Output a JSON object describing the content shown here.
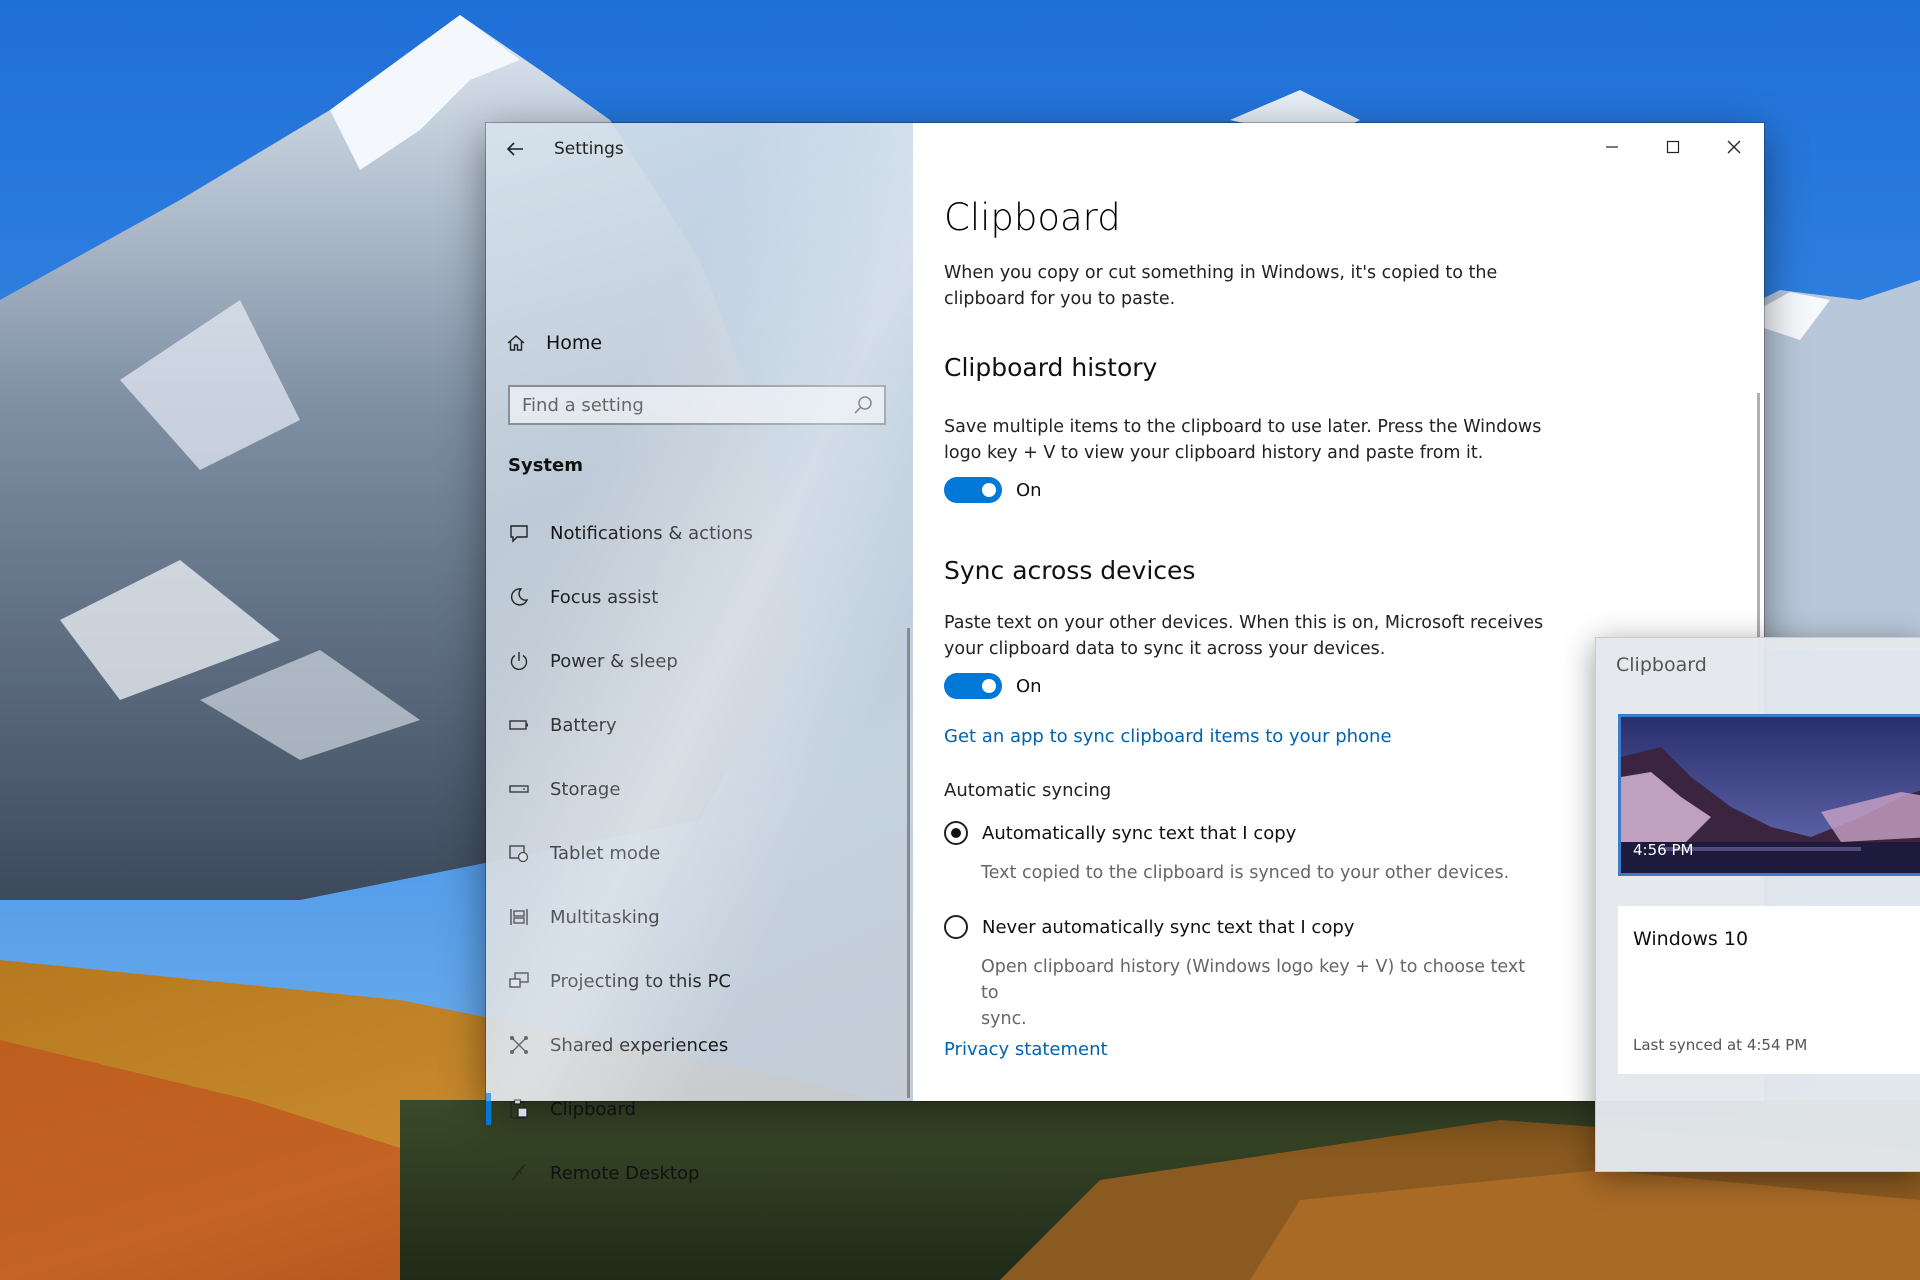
{
  "window": {
    "title": "Settings"
  },
  "nav": {
    "home_label": "Home",
    "search_placeholder": "Find a setting",
    "section_label": "System",
    "items": [
      {
        "label": "Notifications & actions",
        "icon": "notifications-icon"
      },
      {
        "label": "Focus assist",
        "icon": "moon-icon"
      },
      {
        "label": "Power & sleep",
        "icon": "power-icon"
      },
      {
        "label": "Battery",
        "icon": "battery-icon"
      },
      {
        "label": "Storage",
        "icon": "storage-icon"
      },
      {
        "label": "Tablet mode",
        "icon": "tablet-icon"
      },
      {
        "label": "Multitasking",
        "icon": "multitasking-icon"
      },
      {
        "label": "Projecting to this PC",
        "icon": "projecting-icon"
      },
      {
        "label": "Shared experiences",
        "icon": "shared-icon"
      },
      {
        "label": "Clipboard",
        "icon": "clipboard-icon",
        "selected": true
      },
      {
        "label": "Remote Desktop",
        "icon": "remote-desktop-icon"
      }
    ]
  },
  "content": {
    "title": "Clipboard",
    "intro_line1": "When you copy or cut something in Windows, it's copied to the",
    "intro_line2": "clipboard for you to paste.",
    "history": {
      "heading": "Clipboard history",
      "desc_line1": "Save multiple items to the clipboard to use later. Press the Windows",
      "desc_line2": "logo key + V to view your clipboard history and paste from it.",
      "toggle_state": "On"
    },
    "sync": {
      "heading": "Sync across devices",
      "desc_line1": "Paste text on your other devices. When this is on, Microsoft receives",
      "desc_line2": "your clipboard data to sync it across your devices.",
      "toggle_state": "On",
      "link": "Get an app to sync clipboard items to your phone",
      "auto_label": "Automatic syncing",
      "option1_label": "Automatically sync text that I copy",
      "option1_desc": "Text copied to the clipboard is synced to your other devices.",
      "option2_label": "Never automatically sync text that I copy",
      "option2_desc_line1": "Open clipboard history (Windows logo key + V) to choose text to",
      "option2_desc_line2": "sync."
    },
    "privacy_link": "Privacy statement"
  },
  "flyout": {
    "title": "Clipboard",
    "image_item_time": "4:56 PM",
    "text_item": "Windows 10",
    "text_item_synced": "Last synced at 4:54 PM"
  },
  "colors": {
    "accent": "#0078d7",
    "link": "#0063b1"
  }
}
